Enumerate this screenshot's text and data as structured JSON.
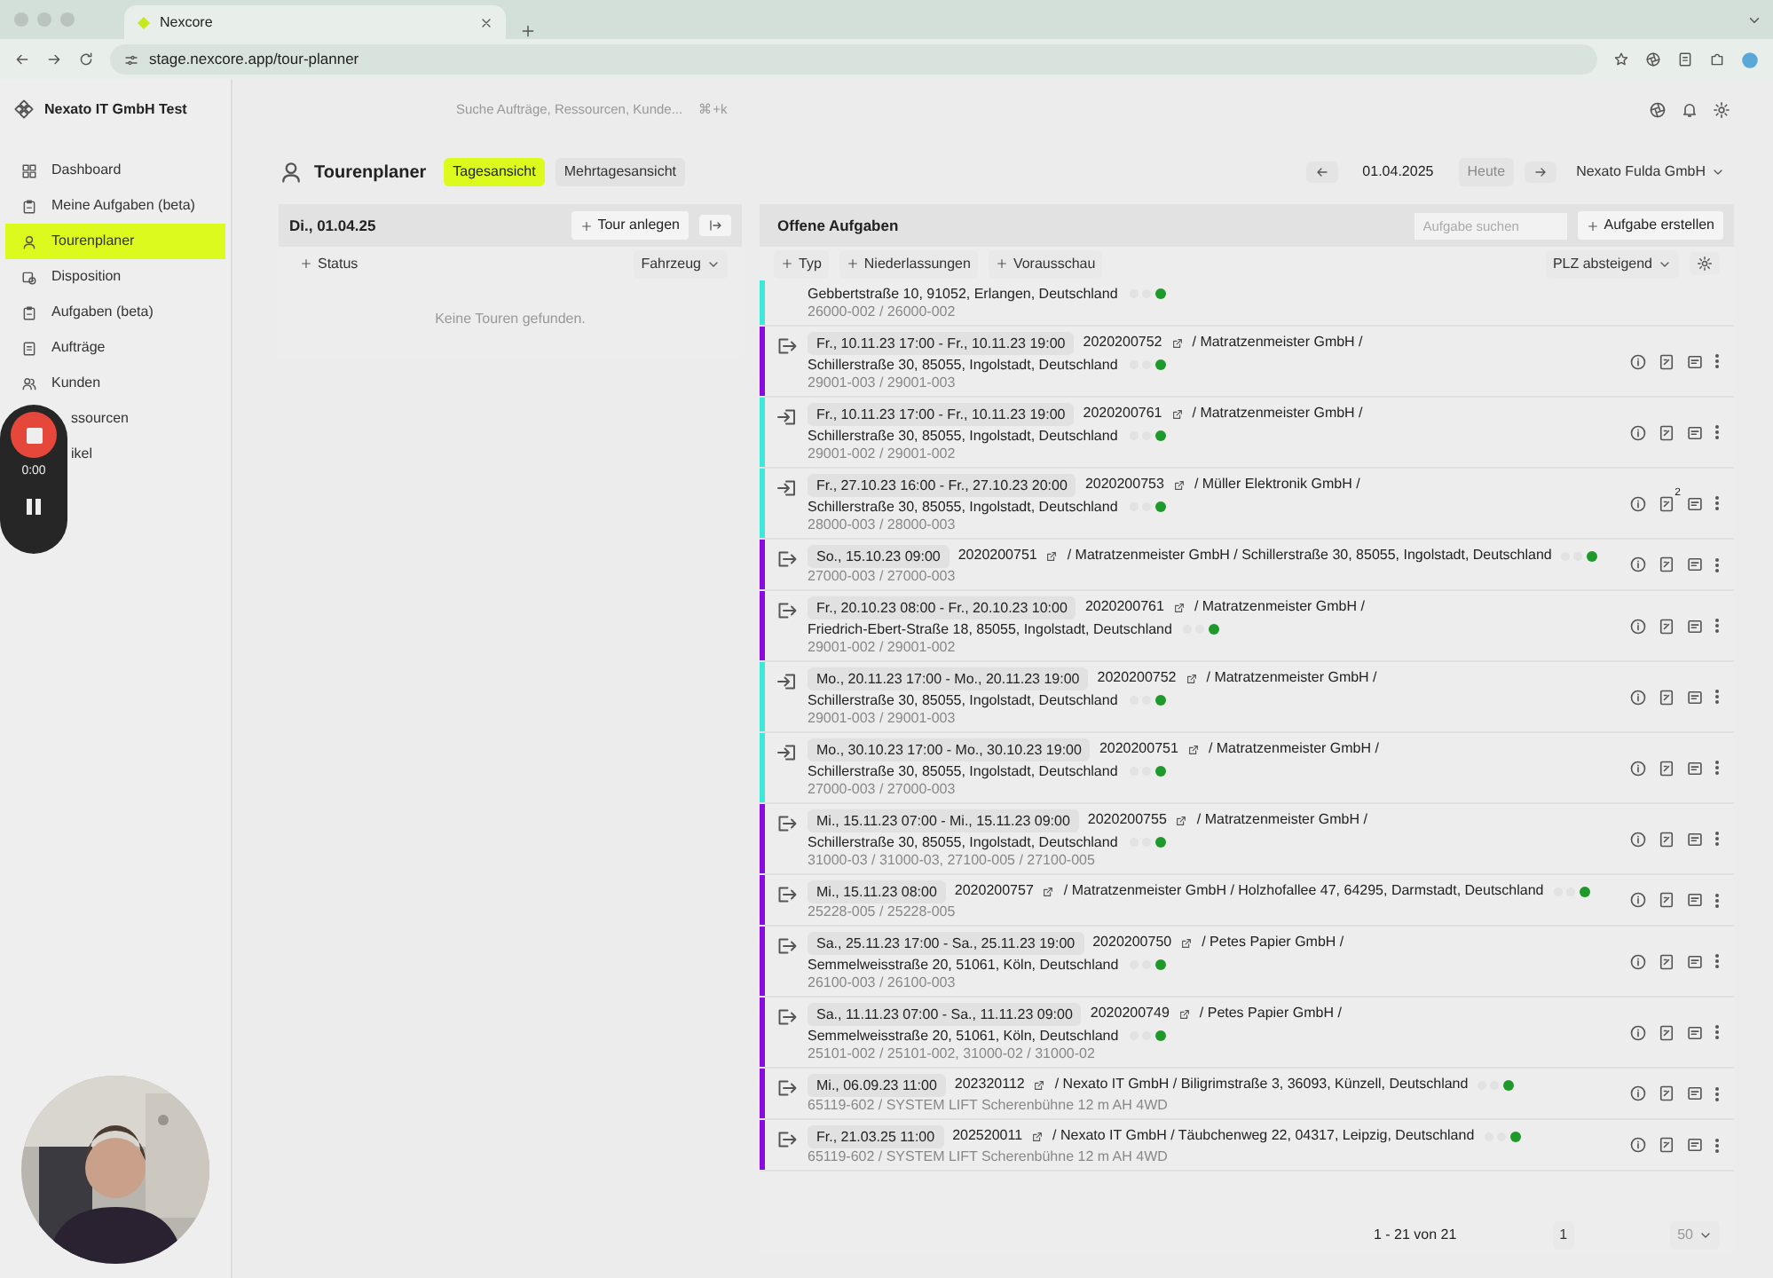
{
  "browser": {
    "tab_title": "Nexcore",
    "url": "stage.nexcore.app/tour-planner"
  },
  "app": {
    "org": "Nexato IT GmbH Test",
    "search": {
      "placeholder": "Suche Aufträge, Ressourcen, Kunde...",
      "shortcut": "⌘+k"
    }
  },
  "sidebar": {
    "items": [
      {
        "label": "Dashboard",
        "kind": "item",
        "selected": false
      },
      {
        "label": "Meine Aufgaben (beta)",
        "kind": "item",
        "selected": false
      },
      {
        "label": "Tourenplaner",
        "kind": "item",
        "selected": true
      },
      {
        "label": "Disposition",
        "kind": "item",
        "selected": false
      },
      {
        "label": "Aufgaben (beta)",
        "kind": "item",
        "selected": false
      },
      {
        "label": "Aufträge",
        "kind": "item",
        "selected": false
      },
      {
        "label": "Kunden",
        "kind": "item",
        "selected": false
      },
      {
        "label": "ssourcen",
        "kind": "covered",
        "selected": false
      },
      {
        "label": "ikel",
        "kind": "covered",
        "selected": false
      }
    ]
  },
  "recorder": {
    "time": "0:00"
  },
  "page": {
    "title": "Tourenplaner",
    "views": [
      {
        "label": "Tagesansicht",
        "selected": true
      },
      {
        "label": "Mehrtagesansicht",
        "selected": false
      }
    ],
    "date": "01.04.2025",
    "today": {
      "label": "Heute",
      "disabled": true
    },
    "branch": "Nexato Fulda GmbH"
  },
  "tours": {
    "date": "Di., 01.04.25",
    "add": "Tour anlegen",
    "filter": "Status",
    "vehicle": "Fahrzeug",
    "empty": "Keine Touren gefunden."
  },
  "tasks": {
    "title": "Offene Aufgaben",
    "search_placeholder": "Aufgabe suchen",
    "create": "Aufgabe erstellen",
    "filters": [
      "Typ",
      "Niederlassungen",
      "Vorausschau"
    ],
    "sort": "PLZ absteigend",
    "rows": [
      {
        "color": "#3de8d8",
        "address": "Gebbertstraße 10, 91052, Erlangen, Deutschland",
        "ref": "26000-002 / 26000-002"
      },
      {
        "color": "#8a0be0",
        "kind": "out",
        "date": "Fr., 10.11.23 17:00 - Fr., 10.11.23 19:00",
        "order": "2020200752",
        "line": "/ Matratzenmeister GmbH /",
        "address": "Schillerstraße 30, 85055, Ingolstadt, Deutschland",
        "ref": "29001-003 / 29001-003"
      },
      {
        "color": "#3de8d8",
        "kind": "in",
        "date": "Fr., 10.11.23 17:00 - Fr., 10.11.23 19:00",
        "order": "2020200761",
        "line": "/ Matratzenmeister GmbH /",
        "address": "Schillerstraße 30, 85055, Ingolstadt, Deutschland",
        "ref": "29001-002 / 29001-002"
      },
      {
        "color": "#3de8d8",
        "kind": "in",
        "date": "Fr., 27.10.23 16:00 - Fr., 27.10.23 20:00",
        "order": "2020200753",
        "line": "/ Müller Elektronik GmbH /",
        "address": "Schillerstraße 30, 85055, Ingolstadt, Deutschland",
        "ref": "28000-003 / 28000-003",
        "badge": "2"
      },
      {
        "color": "#8a0be0",
        "kind": "out",
        "date": "So., 15.10.23 09:00",
        "order": "2020200751",
        "line": "/ Matratzenmeister GmbH / Schillerstraße 30, 85055, Ingolstadt, Deutschland",
        "ref": "27000-003 / 27000-003"
      },
      {
        "color": "#8a0be0",
        "kind": "out",
        "date": "Fr., 20.10.23 08:00 - Fr., 20.10.23 10:00",
        "order": "2020200761",
        "line": "/ Matratzenmeister GmbH /",
        "address": "Friedrich-Ebert-Straße 18, 85055, Ingolstadt, Deutschland",
        "ref": "29001-002 / 29001-002"
      },
      {
        "color": "#3de8d8",
        "kind": "in",
        "date": "Mo., 20.11.23 17:00 - Mo., 20.11.23 19:00",
        "order": "2020200752",
        "line": "/ Matratzenmeister GmbH /",
        "address": "Schillerstraße 30, 85055, Ingolstadt, Deutschland",
        "ref": "29001-003 / 29001-003"
      },
      {
        "color": "#3de8d8",
        "kind": "in",
        "date": "Mo., 30.10.23 17:00 - Mo., 30.10.23 19:00",
        "order": "2020200751",
        "line": "/ Matratzenmeister GmbH /",
        "address": "Schillerstraße 30, 85055, Ingolstadt, Deutschland",
        "ref": "27000-003 / 27000-003"
      },
      {
        "color": "#8a0be0",
        "kind": "out",
        "date": "Mi., 15.11.23 07:00 - Mi., 15.11.23 09:00",
        "order": "2020200755",
        "line": "/ Matratzenmeister GmbH /",
        "address": "Schillerstraße 30, 85055, Ingolstadt, Deutschland",
        "ref": "31000-03 / 31000-03, 27100-005 / 27100-005"
      },
      {
        "color": "#8a0be0",
        "kind": "out",
        "date": "Mi., 15.11.23 08:00",
        "order": "2020200757",
        "line": "/ Matratzenmeister GmbH / Holzhofallee 47, 64295, Darmstadt, Deutschland",
        "ref": "25228-005 / 25228-005"
      },
      {
        "color": "#8a0be0",
        "kind": "out",
        "date": "Sa., 25.11.23 17:00 - Sa., 25.11.23 19:00",
        "order": "2020200750",
        "line": "/ Petes Papier GmbH /",
        "address": "Semmelweisstraße 20, 51061, Köln, Deutschland",
        "ref": "26100-003 / 26100-003"
      },
      {
        "color": "#8a0be0",
        "kind": "out",
        "date": "Sa., 11.11.23 07:00 - Sa., 11.11.23 09:00",
        "order": "2020200749",
        "line": "/ Petes Papier GmbH /",
        "address": "Semmelweisstraße 20, 51061, Köln, Deutschland",
        "ref": "25101-002 / 25101-002, 31000-02 / 31000-02"
      },
      {
        "color": "#8a0be0",
        "kind": "out",
        "date": "Mi., 06.09.23 11:00",
        "order": "202320112",
        "line": "/ Nexato IT GmbH / Biligrimstraße 3, 36093, Künzell, Deutschland",
        "ref": "65119-602 / SYSTEM LIFT Scherenbühne 12 m AH 4WD"
      },
      {
        "color": "#8a0be0",
        "kind": "out",
        "date": "Fr., 21.03.25 11:00",
        "order": "202520011",
        "line": "/ Nexato IT GmbH / Täubchenweg 22, 04317, Leipzig, Deutschland",
        "ref": "65119-602 / SYSTEM LIFT Scherenbühne 12 m AH 4WD"
      }
    ],
    "pagination": {
      "range": "1 - 21 von 21",
      "page": "1",
      "per_page": "50"
    }
  }
}
